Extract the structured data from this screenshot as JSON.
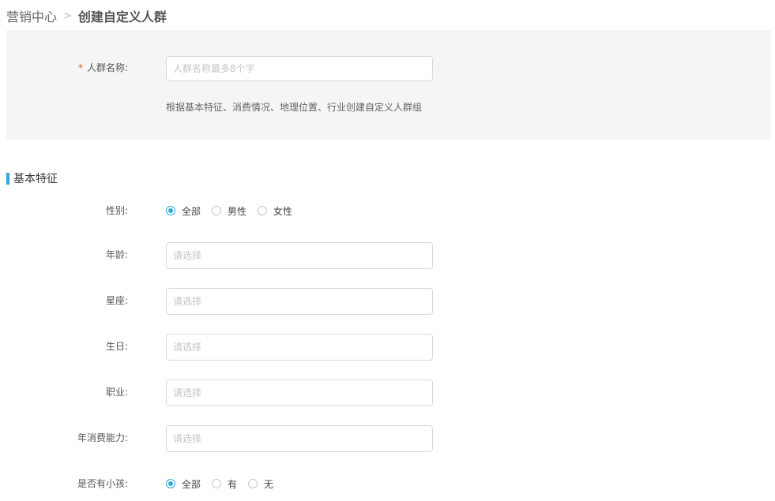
{
  "breadcrumb": {
    "parent": "营销中心",
    "separator": ">",
    "current": "创建自定义人群"
  },
  "name_section": {
    "required_mark": "*",
    "label": "人群名称:",
    "placeholder": "人群名称最多8个字",
    "hint": "根据基本特征、消费情况、地理位置、行业创建自定义人群组"
  },
  "basic_features": {
    "title": "基本特征",
    "gender": {
      "label": "性别:",
      "options": [
        {
          "label": "全部",
          "checked": true
        },
        {
          "label": "男性",
          "checked": false
        },
        {
          "label": "女性",
          "checked": false
        }
      ]
    },
    "age": {
      "label": "年龄:",
      "placeholder": "请选择"
    },
    "zodiac": {
      "label": "星座:",
      "placeholder": "请选择"
    },
    "birthday": {
      "label": "生日:",
      "placeholder": "请选择"
    },
    "occupation": {
      "label": "职业:",
      "placeholder": "请选择"
    },
    "spending": {
      "label": "年消费能力:",
      "placeholder": "请选择"
    },
    "children": {
      "label": "是否有小孩:",
      "options": [
        {
          "label": "全部",
          "checked": true
        },
        {
          "label": "有",
          "checked": false
        },
        {
          "label": "无",
          "checked": false
        }
      ]
    }
  },
  "colors": {
    "accent": "#2eaadc",
    "required": "#e4572e",
    "panel_bg": "#f5f5f5"
  }
}
